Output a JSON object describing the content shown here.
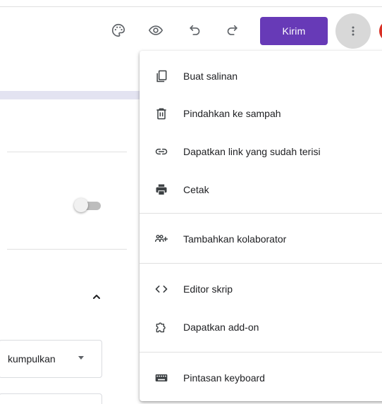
{
  "toolbar": {
    "palette_icon": "palette-icon",
    "preview_icon": "eye-icon",
    "undo_icon": "undo-icon",
    "redo_icon": "redo-icon",
    "send_label": "Kirim",
    "more_icon": "more-vert-icon",
    "accent_color": "#673ab7"
  },
  "form_background": {
    "select_value": "kumpulkan",
    "toggle_on": false
  },
  "menu": {
    "items": [
      {
        "label": "Buat salinan",
        "icon": "copy-icon"
      },
      {
        "label": "Pindahkan ke sampah",
        "icon": "trash-icon"
      },
      {
        "label": "Dapatkan link yang sudah terisi",
        "icon": "link-icon"
      },
      {
        "label": "Cetak",
        "icon": "print-icon"
      },
      {
        "label": "Tambahkan kolaborator",
        "icon": "add-collaborator-icon"
      },
      {
        "label": "Editor skrip",
        "icon": "code-icon"
      },
      {
        "label": "Dapatkan add-on",
        "icon": "puzzle-icon"
      },
      {
        "label": "Pintasan keyboard",
        "icon": "keyboard-icon"
      }
    ]
  }
}
